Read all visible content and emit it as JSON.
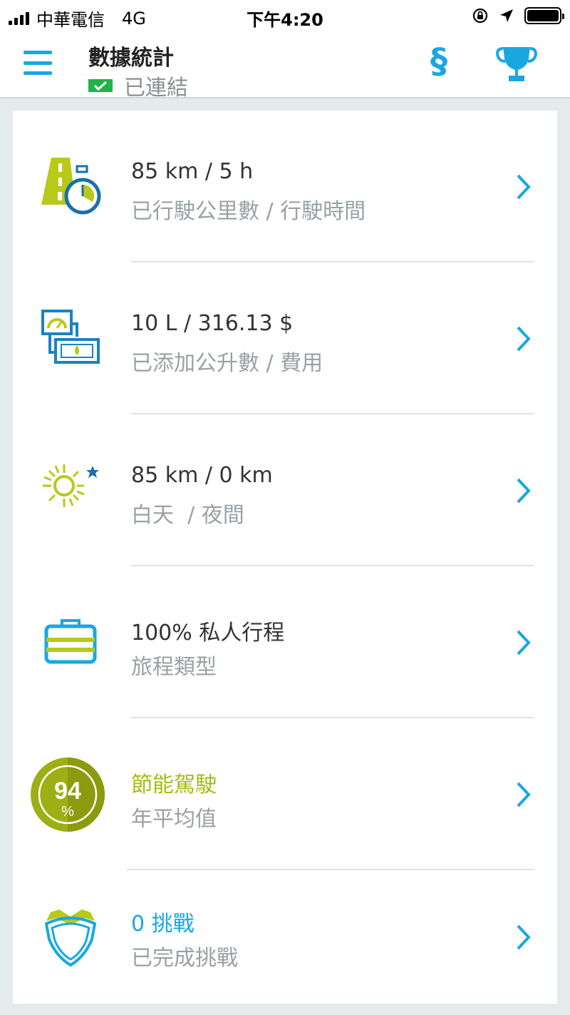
{
  "status_bar": {
    "carrier": "中華電信",
    "network": "4G",
    "time": "下午4:20"
  },
  "header": {
    "title": "數據統計",
    "connection_status": "已連結",
    "section_label": "§"
  },
  "rows": [
    {
      "primary": "85 km / 5 h",
      "secondary": "已行駛公里數 / 行駛時間",
      "icon": "road-stopwatch-icon"
    },
    {
      "primary": "10 L / 316.13 $",
      "secondary": "已添加公升數 / 費用",
      "icon": "fuel-gauge-money-icon"
    },
    {
      "primary": "85 km / 0 km",
      "secondary": "白天  / 夜間",
      "icon": "sun-moon-icon"
    },
    {
      "primary": "100% 私人行程",
      "secondary": "旅程類型",
      "icon": "suitcase-icon"
    },
    {
      "primary": "節能駕駛",
      "secondary": "年平均值",
      "icon": "eco-score-badge-icon",
      "score": "94",
      "score_unit": "%"
    },
    {
      "primary": "0 挑戰",
      "secondary": "已完成挑戰",
      "icon": "shield-icon"
    }
  ],
  "colors": {
    "accent_blue": "#1aa7e0",
    "accent_lime": "#a6bb12",
    "secondary_text": "#9aa0a4"
  }
}
